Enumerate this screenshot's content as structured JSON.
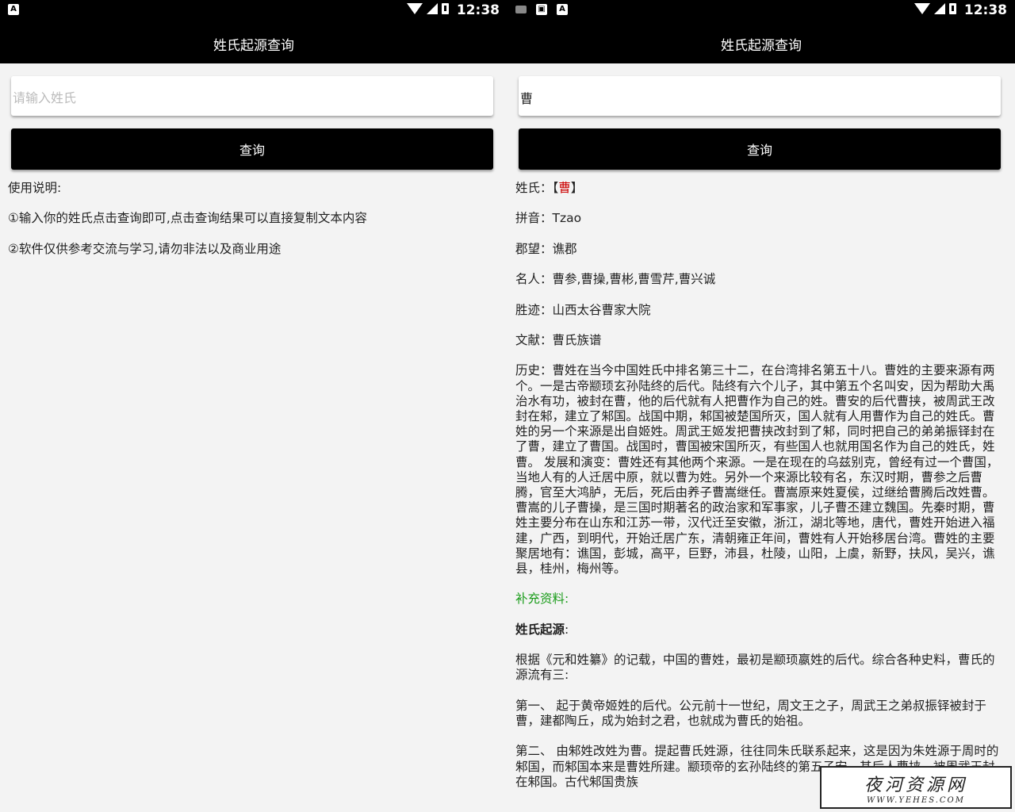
{
  "left_screen": {
    "status": {
      "clock": "12:38",
      "notif_icon": "A"
    },
    "app_title": "姓氏起源查询",
    "search": {
      "placeholder": "请输入姓氏",
      "value": ""
    },
    "query_button": "查询",
    "instructions": {
      "heading": "使用说明:",
      "item1": "①输入你的姓氏点击查询即可,点击查询结果可以直接复制文本内容",
      "item2": "②软件仅供参考交流与学习,请勿非法以及商业用途"
    }
  },
  "right_screen": {
    "status": {
      "clock": "12:38",
      "notif_icons": [
        "keyboard-icon",
        "image-icon",
        "A"
      ]
    },
    "app_title": "姓氏起源查询",
    "search": {
      "placeholder": "请输入姓氏",
      "value": "曹"
    },
    "query_button": "查询",
    "result": {
      "surname_label": "姓氏：",
      "surname_open": "【",
      "surname_value": "曹",
      "surname_close": "】",
      "pinyin": "拼音：Tzao",
      "junwang": "郡望：谯郡",
      "famous": "名人：曹参,曹操,曹彬,曹雪芹,曹兴诚",
      "sites": "胜迹：山西太谷曹家大院",
      "literature": "文献：曹氏族谱",
      "history": "历史：曹姓在当今中国姓氏中排名第三十二，在台湾排名第五十八。曹姓的主要来源有两个。一是古帝颛顼玄孙陆终的后代。陆终有六个儿子，其中第五个名叫安，因为帮助大禹治水有功，被封在曹，他的后代就有人把曹作为自己的姓。曹安的后代曹挟，被周武王改封在邾，建立了邾国。战国中期，邾国被楚国所灭，国人就有人用曹作为自己的姓氏。曹姓的另一个来源是出自姬姓。周武王姬发把曹挟改封到了邾，同时把自己的弟弟振铎封在了曹，建立了曹国。战国时，曹国被宋国所灭，有些国人也就用国名作为自己的姓氏，姓曹。 发展和演变：曹姓还有其他两个来源。一是在现在的乌兹别克，曾经有过一个曹国，当地人有的人迁居中原，就以曹为姓。另外一个来源比较有名，东汉时期，曹参之后曹腾，官至大鸿胪，无后，死后由养子曹嵩继任。曹嵩原来姓夏侯，过继给曹腾后改姓曹。曹嵩的儿子曹操，是三国时期著名的政治家和军事家，儿子曹丕建立魏国。先秦时期，曹姓主要分布在山东和江苏一带，汉代迁至安徽，浙江，湖北等地，唐代，曹姓开始进入福建，广西，到明代，开始迁居广东，清朝雍正年间，曹姓有人开始移居台湾。曹姓的主要聚居地有：谯国，彭城，高平，巨野，沛县，杜陵，山阳，上虞，新野，扶风，吴兴，谯县，桂州，梅州等。",
      "supplement_label": "补充资料:",
      "origin_heading": "姓氏起源",
      "origin_colon": ":",
      "origin_p1": "根据《元和姓纂》的记载，中国的曹姓，最初是颛顼嬴姓的后代。综合各种史料，曹氏的源流有三:",
      "origin_p2": "第一、 起于黄帝姬姓的后代。公元前十一世纪，周文王之子，周武王之弟叔振铎被封于曹，建都陶丘，成为始封之君，也就成为曹氏的始祖。",
      "origin_p3": "第二、 由邾姓改姓为曹。提起曹氏姓源，往往同朱氏联系起来，这是因为朱姓源于周时的邾国，而邾国本来是曹姓所建。颛顼帝的玄孙陆终的第五子安，其后人曹挟，被周武王封在邾国。古代邾国贵族"
    }
  },
  "watermark": {
    "title": "夜河资源网",
    "url": "WWW.YEHES.COM"
  }
}
